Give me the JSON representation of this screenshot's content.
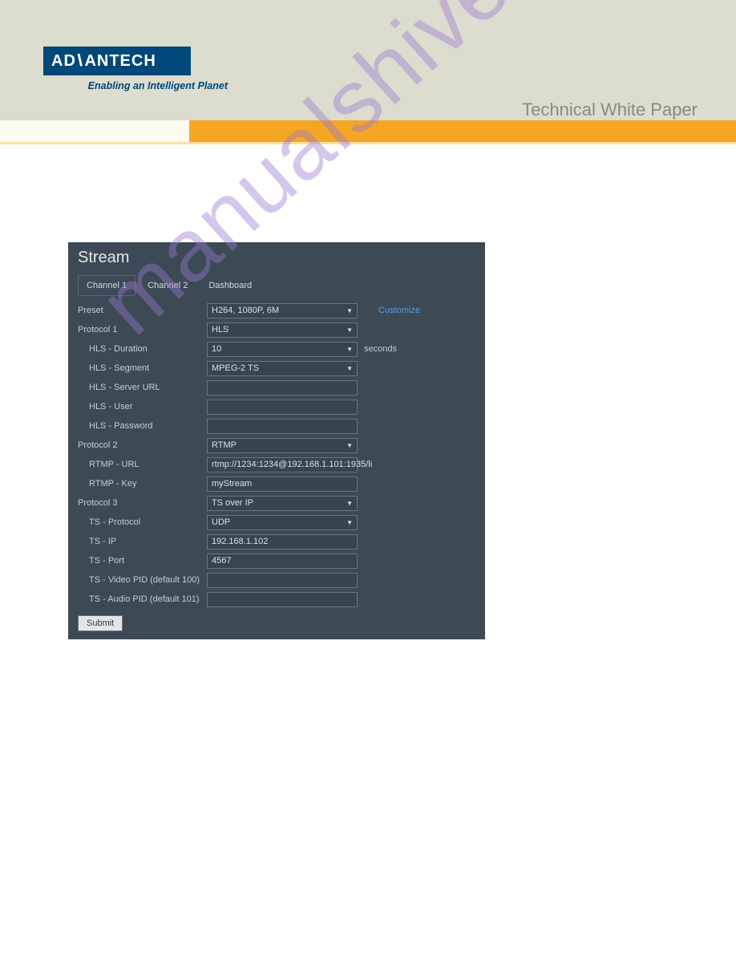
{
  "header": {
    "logo_text": "AD\\ANTECH",
    "tagline": "Enabling an Intelligent Planet",
    "right_text": "Technical White Paper"
  },
  "watermark": "manualshive.com",
  "panel": {
    "title": "Stream",
    "tabs": [
      "Channel 1",
      "Channel 2",
      "Dashboard"
    ],
    "customize": "Customize",
    "rows": {
      "preset_label": "Preset",
      "preset_value": "H264, 1080P, 6M",
      "protocol1_label": "Protocol 1",
      "protocol1_value": "HLS",
      "hls_duration_label": "HLS - Duration",
      "hls_duration_value": "10",
      "hls_duration_unit": "seconds",
      "hls_segment_label": "HLS - Segment",
      "hls_segment_value": "MPEG-2 TS",
      "hls_server_label": "HLS - Server URL",
      "hls_server_value": "",
      "hls_user_label": "HLS - User",
      "hls_user_value": "",
      "hls_password_label": "HLS - Password",
      "hls_password_value": "",
      "protocol2_label": "Protocol 2",
      "protocol2_value": "RTMP",
      "rtmp_url_label": "RTMP - URL",
      "rtmp_url_value": "rtmp://1234:1234@192.168.1.101:1935/li",
      "rtmp_key_label": "RTMP - Key",
      "rtmp_key_value": "myStream",
      "protocol3_label": "Protocol 3",
      "protocol3_value": "TS over IP",
      "ts_protocol_label": "TS - Protocol",
      "ts_protocol_value": "UDP",
      "ts_ip_label": "TS - IP",
      "ts_ip_value": "192.168.1.102",
      "ts_port_label": "TS - Port",
      "ts_port_value": "4567",
      "ts_video_label": "TS - Video PID (default 100)",
      "ts_video_value": "",
      "ts_audio_label": "TS - Audio PID (default 101)",
      "ts_audio_value": "",
      "submit": "Submit"
    }
  }
}
